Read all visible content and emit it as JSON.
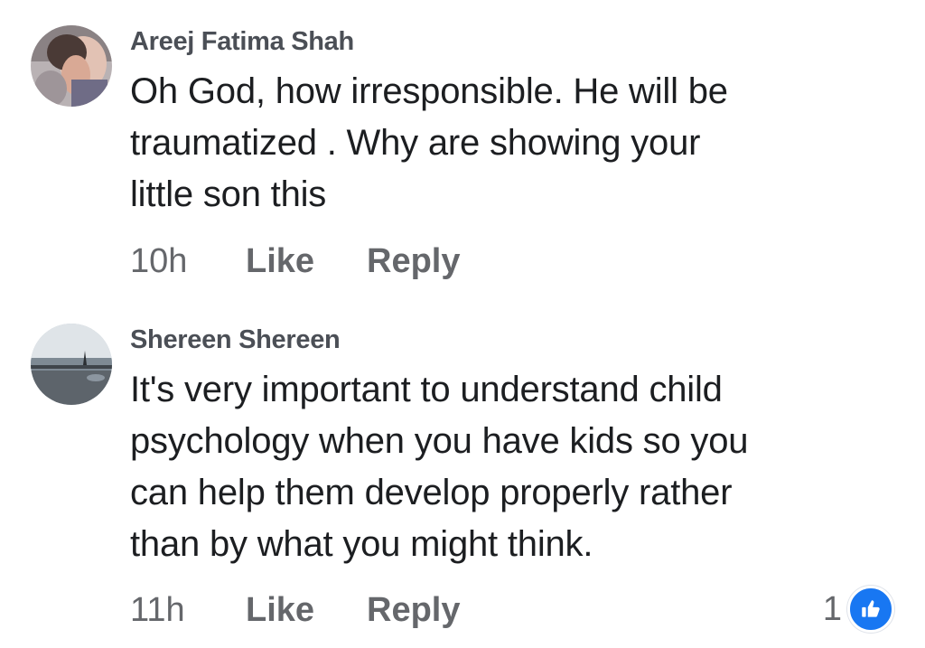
{
  "comments": [
    {
      "author": "Areej Fatima Shah",
      "lines": [
        "Oh God, how irresponsible. He will be",
        "traumatized . Why are showing your",
        "little son this"
      ],
      "time": "10h",
      "like_label": "Like",
      "reply_label": "Reply",
      "avatar_icon": "profile-photo"
    },
    {
      "author": "Shereen Shereen",
      "lines": [
        "It's very important to understand child",
        "psychology when you have kids so you",
        "can help them develop properly rather",
        "than by what you might think."
      ],
      "time": "11h",
      "like_label": "Like",
      "reply_label": "Reply",
      "avatar_icon": "profile-photo",
      "reaction_count": "1",
      "reaction_icon": "thumbs-up-icon"
    }
  ],
  "colors": {
    "accent": "#1877f2",
    "secondary_text": "#65676b",
    "author_text": "#4b4f56",
    "body_text": "#1c1e21"
  }
}
